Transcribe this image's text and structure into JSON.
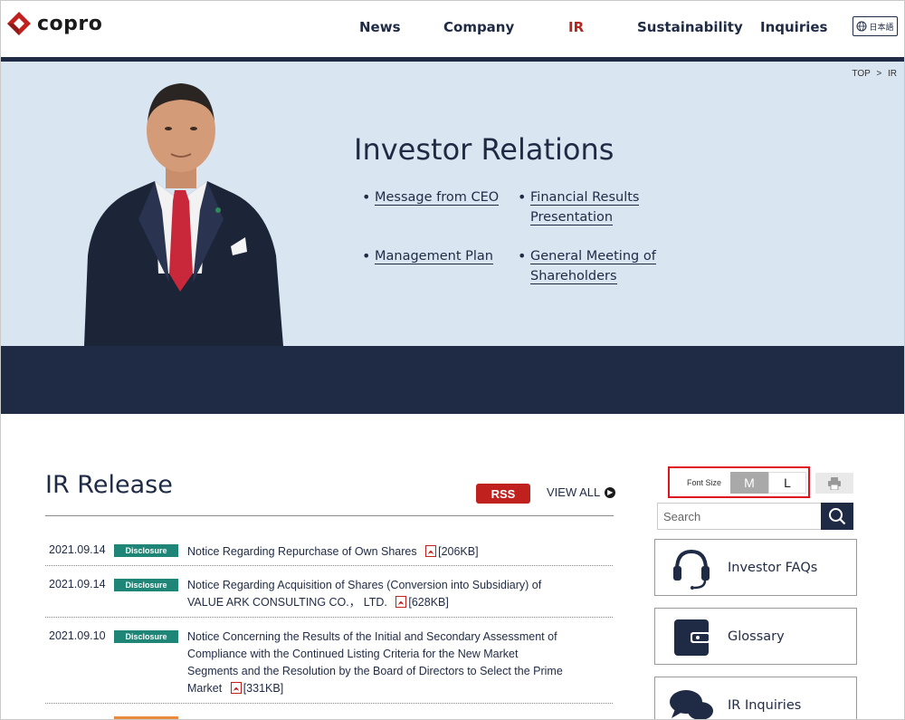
{
  "header": {
    "logo_text": "copro",
    "nav": [
      "News",
      "Company",
      "IR",
      "Sustainability",
      "Inquiries"
    ],
    "active_nav": "IR",
    "lang_label": "日本語"
  },
  "breadcrumb": {
    "top": "TOP",
    "sep": ">",
    "current": "IR"
  },
  "hero": {
    "title": "Investor Relations",
    "links": {
      "ceo": "Message from CEO",
      "financial_1": "Financial Results",
      "financial_2": "Presentation",
      "plan": "Management Plan",
      "meeting_1": "General Meeting of",
      "meeting_2": "Shareholders"
    }
  },
  "ir_release": {
    "title": "IR Release",
    "rss_label": "RSS",
    "view_all_label": "VIEW ALL",
    "items": [
      {
        "date": "2021.09.14",
        "tag": "Disclosure",
        "lines": [
          "Notice Regarding Repurchase of Own Shares"
        ],
        "size": "[206KB]"
      },
      {
        "date": "2021.09.14",
        "tag": "Disclosure",
        "lines": [
          "Notice Regarding Acquisition of Shares (Conversion into Subsidiary) of",
          "VALUE ARK CONSULTING CO.， LTD."
        ],
        "size": "[628KB]"
      },
      {
        "date": "2021.09.10",
        "tag": "Disclosure",
        "lines": [
          "Notice Concerning the Results of the Initial and Secondary Assessment of",
          "Compliance with the Continued Listing Criteria for the New Market",
          "Segments and the Resolution by the Board of Directors to Select the Prime",
          "Market"
        ],
        "size": "[331KB]"
      }
    ]
  },
  "font_size": {
    "label": "Font Size",
    "m": "M",
    "l": "L",
    "selected": "M"
  },
  "search": {
    "placeholder": "Search"
  },
  "side_links": [
    "Investor FAQs",
    "Glossary",
    "IR Inquiries"
  ],
  "colors": {
    "navy": "#1f2a44",
    "accent_red": "#b3261e",
    "disclosure_green": "#1f8577",
    "hero_bg": "#d9e6f2"
  }
}
